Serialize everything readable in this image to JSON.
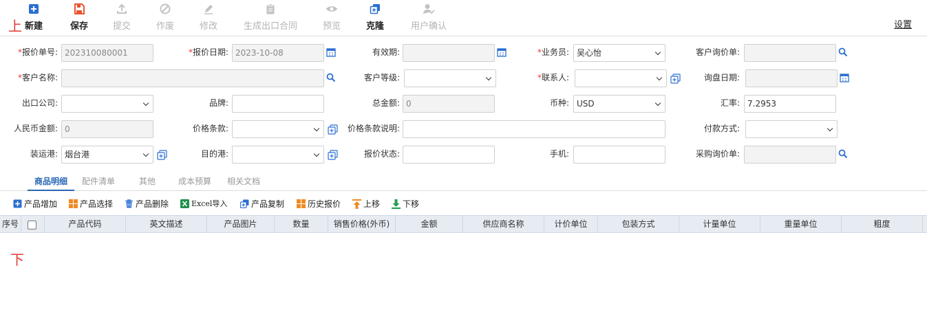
{
  "toolbar": {
    "new": "新建",
    "save": "保存",
    "submit": "提交",
    "void": "作废",
    "modify": "修改",
    "gen_contract": "生成出口合同",
    "preview": "预览",
    "clone": "克隆",
    "user_confirm": "用户确认",
    "settings": "设置"
  },
  "markers": {
    "top": "上",
    "bottom": "下"
  },
  "form": {
    "quote_no": {
      "label": "报价单号:",
      "value": "202310080001"
    },
    "quote_date": {
      "label": "报价日期:",
      "value": "2023-10-08"
    },
    "validity": {
      "label": "有效期:",
      "value": ""
    },
    "salesman": {
      "label": "业务员:",
      "value": "吴心怡"
    },
    "customer_inquiry": {
      "label": "客户询价单:",
      "value": ""
    },
    "customer_name": {
      "label": "客户名称:",
      "value": ""
    },
    "customer_level": {
      "label": "客户等级:",
      "value": ""
    },
    "contact": {
      "label": "联系人:",
      "value": ""
    },
    "inquiry_date": {
      "label": "询盘日期:",
      "value": ""
    },
    "export_company": {
      "label": "出口公司:",
      "value": ""
    },
    "brand": {
      "label": "品牌:",
      "value": ""
    },
    "total_amount": {
      "label": "总金额:",
      "value": "0"
    },
    "currency": {
      "label": "币种:",
      "value": "USD"
    },
    "exchange_rate": {
      "label": "汇率:",
      "value": "7.2953"
    },
    "rmb_amount": {
      "label": "人民币金额:",
      "value": "0"
    },
    "price_terms": {
      "label": "价格条款:",
      "value": ""
    },
    "price_terms_desc": {
      "label": "价格条款说明:",
      "value": ""
    },
    "payment_method": {
      "label": "付款方式:",
      "value": ""
    },
    "loading_port": {
      "label": "装运港:",
      "value": "烟台港"
    },
    "destination_port": {
      "label": "目的港:",
      "value": ""
    },
    "quote_status": {
      "label": "报价状态:",
      "value": ""
    },
    "mobile": {
      "label": "手机:",
      "value": ""
    },
    "purchase_inquiry": {
      "label": "采购询价单:",
      "value": ""
    }
  },
  "tabs": [
    "商品明细",
    "配件清单",
    "其他",
    "成本预算",
    "相关文档"
  ],
  "grid_tools": {
    "add": "产品增加",
    "select": "产品选择",
    "delete": "产品删除",
    "excel_import": "Excel导入",
    "copy": "产品复制",
    "history": "历史报价",
    "move_up": "上移",
    "move_down": "下移"
  },
  "table": {
    "columns": [
      "序号",
      "产品代码",
      "英文描述",
      "产品图片",
      "数量",
      "销售价格(外币)",
      "金额",
      "供应商名称",
      "计价单位",
      "包装方式",
      "计量单位",
      "重量单位",
      "粗度"
    ]
  },
  "colors": {
    "accent": "#2767b5",
    "required": "#e53935",
    "header_bg": "#e7ecf3"
  }
}
